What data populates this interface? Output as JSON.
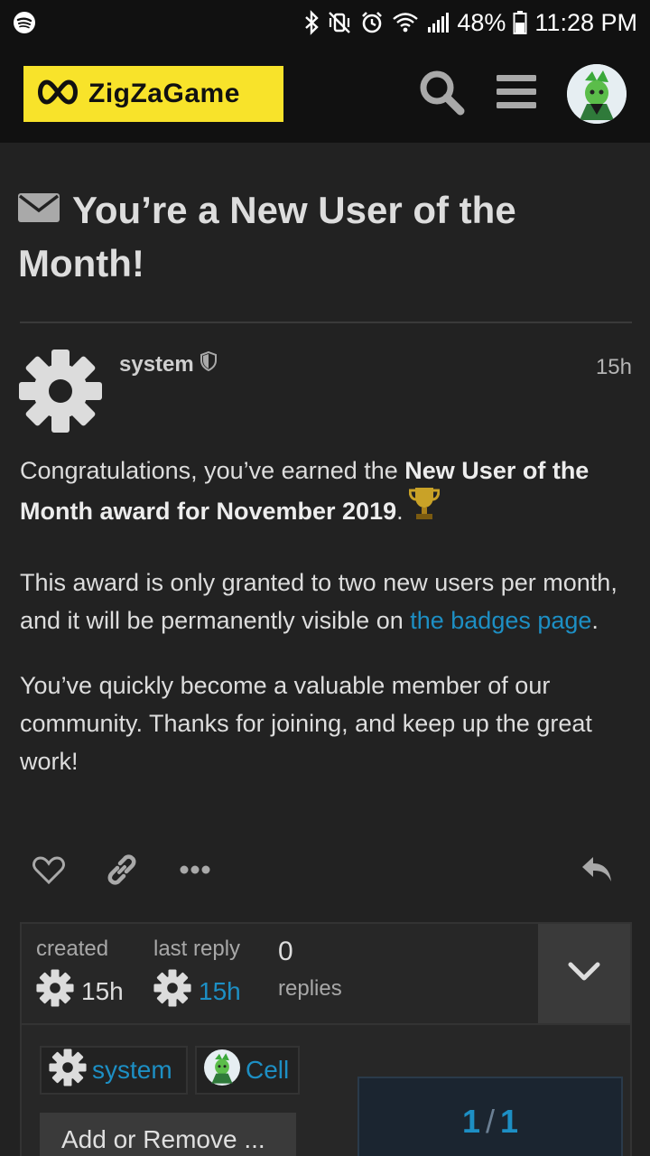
{
  "status_bar": {
    "battery_percent": "48%",
    "time": "11:28 PM",
    "icons": [
      "spotify-icon",
      "bluetooth-icon",
      "vibrate-off-icon",
      "alarm-icon",
      "wifi-icon",
      "signal-icon",
      "battery-icon"
    ]
  },
  "header": {
    "logo_text": "ZigZaGame",
    "brand_color": "#f8e32a",
    "icons": [
      "search-icon",
      "menu-icon",
      "avatar"
    ]
  },
  "topic": {
    "title": "You’re a New User of the Month!",
    "icon": "envelope-icon"
  },
  "post": {
    "username": "system",
    "time": "15h",
    "paragraph1_prefix": "Congratulations, you’ve earned the ",
    "paragraph1_bold": "New User of the Month award for November 2019",
    "paragraph1_suffix": ".",
    "paragraph2_prefix": "This award is only granted to two new users per month, and it will be permanently visible on ",
    "paragraph2_link": "the badges page",
    "paragraph2_suffix": ".",
    "paragraph3": "You’ve quickly become a valuable member of our community. Thanks for joining, and keep up the great work!",
    "link_color": "#1d8fc4"
  },
  "post_actions": [
    "like-icon",
    "link-icon",
    "more-icon",
    "reply-icon"
  ],
  "topic_map": {
    "created_label": "created",
    "created_value": "15h",
    "last_reply_label": "last reply",
    "last_reply_value": "15h",
    "replies_count": "0",
    "replies_label": "replies"
  },
  "participants": [
    {
      "name": "system"
    },
    {
      "name": "Cell"
    }
  ],
  "add_remove_label": "Add or Remove ...",
  "progress": {
    "current": "1",
    "total": "1"
  }
}
